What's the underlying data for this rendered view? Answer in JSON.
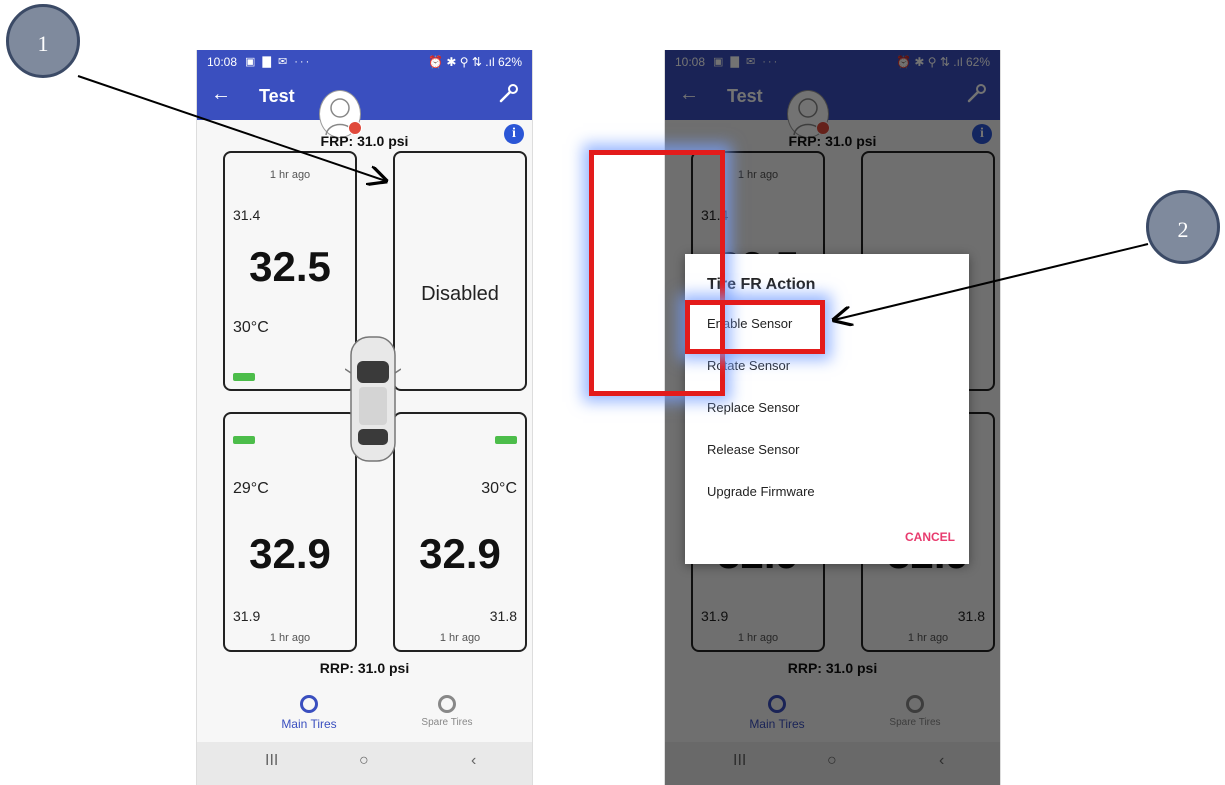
{
  "callouts": {
    "first": "1",
    "second": "2"
  },
  "status": {
    "time": "10:08",
    "icons": "▣ ▇ ✉ ···",
    "right": "⏰ ✱ ⚲ ⇅ .ıl 62%"
  },
  "appbar": {
    "title": "Test"
  },
  "pressures": {
    "front": "FRP: 31.0 psi",
    "rear": "RRP: 31.0 psi"
  },
  "tires": {
    "fl": {
      "time_ago": "1 hr ago",
      "small": "31.4",
      "big": "32.5",
      "temp": "30°C"
    },
    "fr": {
      "status": "Disabled"
    },
    "rl": {
      "temp": "29°C",
      "big": "32.9",
      "small": "31.9",
      "time_ago": "1 hr ago"
    },
    "rr": {
      "temp": "30°C",
      "big": "32.9",
      "small": "31.8",
      "time_ago": "1 hr ago"
    }
  },
  "bottom_nav": {
    "main": "Main Tires",
    "spare": "Spare Tires"
  },
  "system_nav": {
    "recents": "III",
    "home": "○",
    "back": "‹"
  },
  "dialog": {
    "title": "Tire FR Action",
    "items": [
      "Enable Sensor",
      "Rotate Sensor",
      "Replace Sensor",
      "Release Sensor",
      "Upgrade Firmware"
    ],
    "cancel": "CANCEL"
  },
  "colors": {
    "appbar": "#3a4fbf",
    "highlight": "#e31b1b",
    "battery": "#4cbd4a",
    "cancel": "#e83b6e",
    "info": "#2b56d6"
  },
  "icons": [
    "back-arrow-icon",
    "wrench-icon",
    "avatar-icon",
    "info-icon",
    "car-icon",
    "main-tires-icon",
    "spare-tires-icon"
  ]
}
